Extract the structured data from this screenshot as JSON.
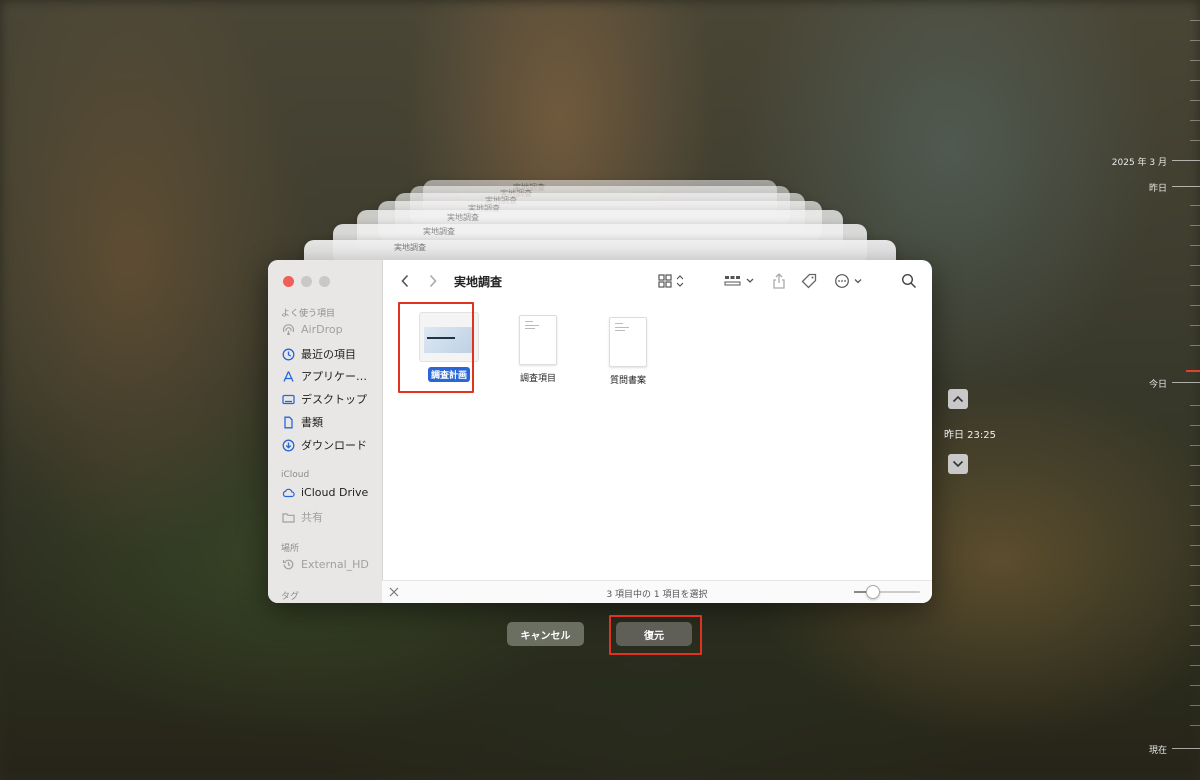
{
  "window": {
    "title": "実地調査",
    "ghost_title": "実地調査"
  },
  "sidebar": {
    "sections": [
      {
        "heading": "よく使う項目",
        "items": [
          {
            "label": "AirDrop",
            "icon": "airdrop-icon",
            "dim": true
          },
          {
            "label": "最近の項目",
            "icon": "clock-icon"
          },
          {
            "label": "アプリケー…",
            "icon": "applications-icon"
          },
          {
            "label": "デスクトップ",
            "icon": "desktop-icon"
          },
          {
            "label": "書類",
            "icon": "document-icon"
          },
          {
            "label": "ダウンロード",
            "icon": "download-icon"
          }
        ]
      },
      {
        "heading": "iCloud",
        "items": [
          {
            "label": "iCloud Drive",
            "icon": "cloud-icon"
          },
          {
            "label": "共有",
            "icon": "shared-folder-icon",
            "dim": true
          }
        ]
      },
      {
        "heading": "場所",
        "items": [
          {
            "label": "External_HD",
            "icon": "history-icon",
            "dim": true
          }
        ]
      },
      {
        "heading": "タグ",
        "items": []
      }
    ]
  },
  "files": [
    {
      "name": "調査計画",
      "selected": true,
      "kind": "presentation"
    },
    {
      "name": "調査項目",
      "selected": false,
      "kind": "document"
    },
    {
      "name": "質問書案",
      "selected": false,
      "kind": "document"
    }
  ],
  "status_text": "3 項目中の 1 項目を選択",
  "buttons": {
    "cancel": "キャンセル",
    "restore": "復元"
  },
  "timeline": {
    "labels": [
      "2025 年 3 月",
      "昨日",
      "今日",
      "現在"
    ],
    "current": "昨日 23:25"
  },
  "colors": {
    "selection": "#2a66d6",
    "highlight": "#e0331f",
    "now_marker": "#e0412f"
  }
}
